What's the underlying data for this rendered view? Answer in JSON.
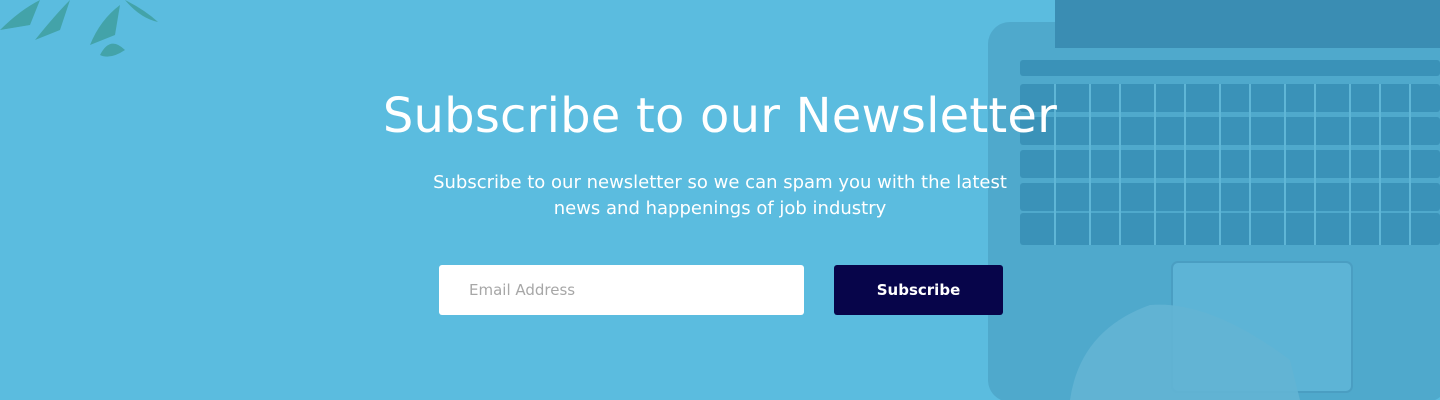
{
  "newsletter": {
    "title": "Subscribe to our Newsletter",
    "subtitle": "Subscribe to our newsletter so we can spam you with the latest news and happenings of job industry",
    "email_placeholder": "Email Address",
    "subscribe_label": "Subscribe"
  },
  "colors": {
    "background": "#5bbcdf",
    "button": "#07054a",
    "text": "#ffffff"
  },
  "icons": [
    "plant-leaves-image",
    "laptop-keyboard-image"
  ]
}
